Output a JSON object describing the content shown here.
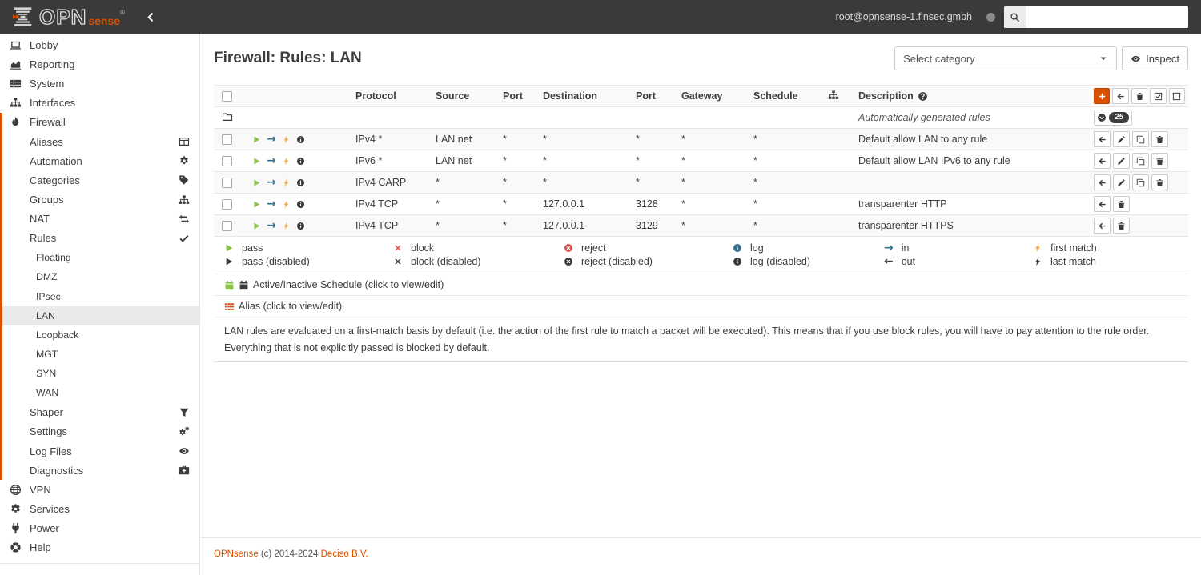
{
  "colors": {
    "brand_orange": "#d94f00",
    "pass_green": "#8bc34a",
    "info_blue": "#31708f",
    "match_orange": "#f0ad4e",
    "block_red": "#d9534f",
    "dark": "#3c3c3c"
  },
  "header": {
    "brand_opn": "OPN",
    "brand_sense": "sense",
    "brand_reg": "®",
    "user": "root@opnsense-1.finsec.gmbh",
    "search_placeholder": ""
  },
  "sidebar": {
    "items": [
      {
        "label": "Lobby",
        "level": 0,
        "icon": "laptop"
      },
      {
        "label": "Reporting",
        "level": 0,
        "icon": "chart"
      },
      {
        "label": "System",
        "level": 0,
        "icon": "thlist"
      },
      {
        "label": "Interfaces",
        "level": 0,
        "icon": "sitemap"
      },
      {
        "label": "Firewall",
        "level": 0,
        "icon": "fire",
        "group": true
      },
      {
        "label": "Aliases",
        "level": 1,
        "right": "table",
        "group": true
      },
      {
        "label": "Automation",
        "level": 1,
        "right": "cog",
        "group": true
      },
      {
        "label": "Categories",
        "level": 1,
        "right": "tags",
        "group": true
      },
      {
        "label": "Groups",
        "level": 1,
        "right": "sitemap",
        "group": true
      },
      {
        "label": "NAT",
        "level": 1,
        "right": "exchange",
        "group": true
      },
      {
        "label": "Rules",
        "level": 1,
        "right": "check",
        "group": true
      },
      {
        "label": "Floating",
        "level": 2,
        "group": true
      },
      {
        "label": "DMZ",
        "level": 2,
        "group": true
      },
      {
        "label": "IPsec",
        "level": 2,
        "group": true
      },
      {
        "label": "LAN",
        "level": 2,
        "group": true,
        "selected": true
      },
      {
        "label": "Loopback",
        "level": 2,
        "group": true
      },
      {
        "label": "MGT",
        "level": 2,
        "group": true
      },
      {
        "label": "SYN",
        "level": 2,
        "group": true
      },
      {
        "label": "WAN",
        "level": 2,
        "group": true
      },
      {
        "label": "Shaper",
        "level": 1,
        "right": "filter",
        "group": true
      },
      {
        "label": "Settings",
        "level": 1,
        "right": "cogs",
        "group": true
      },
      {
        "label": "Log Files",
        "level": 1,
        "right": "eye",
        "group": true
      },
      {
        "label": "Diagnostics",
        "level": 1,
        "right": "medkit",
        "group": true
      },
      {
        "label": "VPN",
        "level": 0,
        "icon": "globe"
      },
      {
        "label": "Services",
        "level": 0,
        "icon": "cog"
      },
      {
        "label": "Power",
        "level": 0,
        "icon": "plug"
      },
      {
        "label": "Help",
        "level": 0,
        "icon": "lifering"
      }
    ]
  },
  "page": {
    "title": "Firewall: Rules: LAN",
    "category_select": "Select category",
    "inspect_label": "Inspect"
  },
  "table": {
    "headers": {
      "protocol": "Protocol",
      "source": "Source",
      "source_port": "Port",
      "destination": "Destination",
      "dest_port": "Port",
      "gateway": "Gateway",
      "schedule": "Schedule",
      "description": "Description"
    },
    "auto_group": {
      "description": "Automatically generated rules",
      "count": "25"
    },
    "rules": [
      {
        "protocol": "IPv4 *",
        "source": "LAN net",
        "source_port": "*",
        "destination": "*",
        "dest_port": "*",
        "gateway": "*",
        "schedule": "*",
        "description": "Default allow LAN to any rule",
        "icons": [
          "pass",
          "in",
          "first-match",
          "info"
        ],
        "actions": [
          "move",
          "edit",
          "clone",
          "delete"
        ]
      },
      {
        "protocol": "IPv6 *",
        "source": "LAN net",
        "source_port": "*",
        "destination": "*",
        "dest_port": "*",
        "gateway": "*",
        "schedule": "*",
        "description": "Default allow LAN IPv6 to any rule",
        "icons": [
          "pass",
          "in",
          "first-match",
          "info"
        ],
        "actions": [
          "move",
          "edit",
          "clone",
          "delete"
        ]
      },
      {
        "protocol": "IPv4 CARP",
        "source": "*",
        "source_port": "*",
        "destination": "*",
        "dest_port": "*",
        "gateway": "*",
        "schedule": "*",
        "description": "",
        "icons": [
          "pass",
          "in",
          "first-match",
          "info"
        ],
        "actions": [
          "move",
          "edit",
          "clone",
          "delete"
        ]
      },
      {
        "protocol": "IPv4 TCP",
        "source": "*",
        "source_port": "*",
        "destination": "127.0.0.1",
        "dest_port": "3128",
        "gateway": "*",
        "schedule": "*",
        "description": "transparenter HTTP",
        "icons": [
          "pass",
          "in",
          "first-match",
          "info"
        ],
        "actions": [
          "move",
          "delete"
        ]
      },
      {
        "protocol": "IPv4 TCP",
        "source": "*",
        "source_port": "*",
        "destination": "127.0.0.1",
        "dest_port": "3129",
        "gateway": "*",
        "schedule": "*",
        "description": "transparenter HTTPS",
        "icons": [
          "pass",
          "in",
          "first-match",
          "info"
        ],
        "actions": [
          "move",
          "delete"
        ]
      }
    ],
    "legend": {
      "cols": [
        {
          "items": [
            {
              "icon": "play",
              "color": "pass_green",
              "label": "pass"
            },
            {
              "icon": "play",
              "color": "dark",
              "label": "pass (disabled)"
            }
          ]
        },
        {
          "items": [
            {
              "icon": "x",
              "color": "block_red",
              "label": "block"
            },
            {
              "icon": "x",
              "color": "dark",
              "label": "block (disabled)"
            }
          ]
        },
        {
          "items": [
            {
              "icon": "circle-x",
              "color": "block_red",
              "label": "reject"
            },
            {
              "icon": "circle-x",
              "color": "dark",
              "label": "reject (disabled)"
            }
          ]
        },
        {
          "items": [
            {
              "icon": "info",
              "color": "info_blue",
              "label": "log"
            },
            {
              "icon": "info",
              "color": "dark",
              "label": "log (disabled)"
            }
          ]
        },
        {
          "items": [
            {
              "icon": "arrow-right",
              "color": "info_blue",
              "label": "in"
            },
            {
              "icon": "arrow-left",
              "color": "dark",
              "label": "out"
            }
          ]
        },
        {
          "items": [
            {
              "icon": "bolt",
              "color": "match_orange",
              "label": "first match"
            },
            {
              "icon": "bolt",
              "color": "dark",
              "label": "last match"
            }
          ]
        }
      ]
    },
    "schedule_row": "Active/Inactive Schedule (click to view/edit)",
    "alias_row": "Alias (click to view/edit)",
    "footnote": "LAN rules are evaluated on a first-match basis by default (i.e. the action of the first rule to match a packet will be executed). This means that if you use block rules, you will have to pay attention to the rule order. Everything that is not explicitly passed is blocked by default."
  },
  "footer": {
    "opnsense": "OPNsense",
    "copyright": "(c) 2014-2024",
    "deciso": "Deciso B.V."
  }
}
